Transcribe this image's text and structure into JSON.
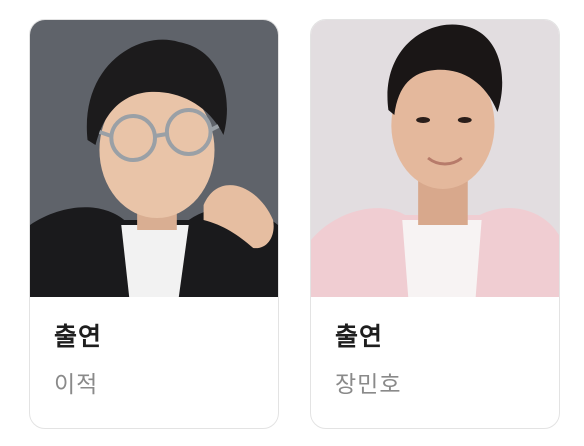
{
  "cast": [
    {
      "role": "출연",
      "name": "이적",
      "photo": {
        "background": "#5f636a",
        "clothing": "#1a1a1c",
        "shirt": "#f2f2f2",
        "skin": "#e9c4a8",
        "hair": "#1c1b1c"
      }
    },
    {
      "role": "출연",
      "name": "장민호",
      "photo": {
        "background": "#e2dde0",
        "clothing": "#f0cdd2",
        "shirt": "#f7f3f3",
        "skin": "#e4b89c",
        "hair": "#1a1616"
      }
    }
  ]
}
